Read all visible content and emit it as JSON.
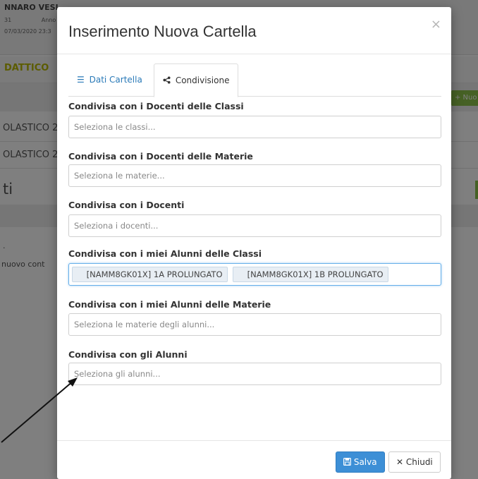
{
  "background": {
    "user_name": "NNARO VESI",
    "info_line_1_a": "31",
    "info_line_1_b": "Anno",
    "info_line_2": "07/03/2020 23:3",
    "section_title": "DATTICO",
    "new_button": "+ Nuo",
    "rows": [
      "OLASTICO 2",
      "OLASTICO 2"
    ],
    "heading": "ti",
    "dot": ".",
    "note": "nuovo cont"
  },
  "modal": {
    "title": "Inserimento Nuova Cartella",
    "close_symbol": "×",
    "tabs": [
      {
        "label": "Dati Cartella",
        "icon": "list-icon",
        "icon_glyph": "☰",
        "active": false
      },
      {
        "label": "Condivisione",
        "icon": "share-icon",
        "icon_glyph": "❮",
        "active": true
      }
    ],
    "fields": [
      {
        "label": "Condivisa con i Docenti delle Classi",
        "placeholder": "Seleziona le classi..."
      },
      {
        "label": "Condivisa con i Docenti delle Materie",
        "placeholder": "Seleziona le materie..."
      },
      {
        "label": "Condivisa con i Docenti",
        "placeholder": "Seleziona i docenti..."
      },
      {
        "label": "Condivisa con i miei Alunni delle Classi",
        "placeholder": "",
        "tags": [
          "[NAMM8GK01X] 1A PROLUNGATO",
          "[NAMM8GK01X] 1B PROLUNGATO"
        ]
      },
      {
        "label": "Condivisa con i miei Alunni delle Materie",
        "placeholder": "Seleziona le materie degli alunni..."
      },
      {
        "label": "Condivisa con gli Alunni",
        "placeholder": "Seleziona gli alunni..."
      }
    ],
    "footer": {
      "save_label": "Salva",
      "save_icon": "floppy-icon",
      "close_label": "Chiudi",
      "close_icon": "times-icon"
    }
  },
  "colors": {
    "accent": "#3d8fd6",
    "link": "#2a7ab8",
    "green": "#8cc34a"
  }
}
